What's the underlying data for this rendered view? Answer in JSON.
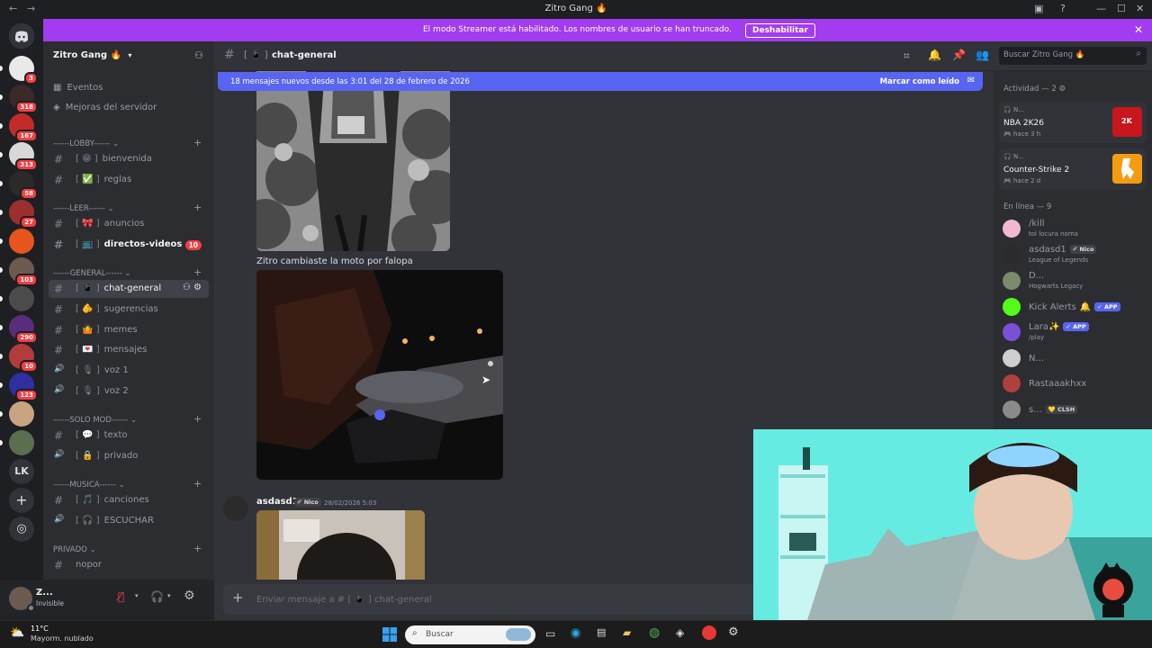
{
  "window": {
    "title": "Zitro Gang 🔥",
    "back_icon": "arrow-left",
    "forward_icon": "arrow-right"
  },
  "banner": {
    "text": "El modo Streamer está habilitado. Los nombres de usuario se han truncado.",
    "button": "Deshabilitar",
    "color": "#a23cf0"
  },
  "rail": {
    "servers": [
      {
        "badge": "3",
        "color": "#e9e9ea"
      },
      {
        "badge": "318",
        "color": "#3a2a2a"
      },
      {
        "badge": "167",
        "color": "#c32b2b"
      },
      {
        "badge": "313",
        "color": "#d8d8d8"
      },
      {
        "badge": "58",
        "color": "#2a2a2a"
      },
      {
        "badge": "27",
        "color": "#9b2f2f"
      },
      {
        "badge": "",
        "color": "#e8541e"
      },
      {
        "badge": "103",
        "color": "#6b5a4f"
      },
      {
        "badge": "",
        "color": "#4b4b4b"
      },
      {
        "badge": "290",
        "color": "#5a2c7c"
      },
      {
        "badge": "10",
        "color": "#b23c3c"
      },
      {
        "badge": "123",
        "color": "#2f2fa0"
      },
      {
        "badge": "",
        "color": "#c9a483"
      },
      {
        "badge": "",
        "color": "#5b6e4d"
      }
    ],
    "lk_label": "LK"
  },
  "sidebar": {
    "server_name": "Zitro Gang 🔥",
    "top_items": [
      "Eventos",
      "Mejoras del servidor"
    ],
    "categories": [
      {
        "label": "------LOBBY------"
      },
      {
        "label": "------LEER------"
      },
      {
        "label": "------GENERAL------"
      },
      {
        "label": "------SOLO MOD------"
      },
      {
        "label": "------MUSICA------"
      },
      {
        "label": "PRIVADO"
      }
    ],
    "channels": [
      {
        "name": "bienvenida",
        "emoji": "😁",
        "type": "text"
      },
      {
        "name": "reglas",
        "emoji": "✅",
        "type": "text"
      },
      {
        "name": "anuncios",
        "emoji": "🎀",
        "type": "text"
      },
      {
        "name": "directos-videos",
        "emoji": "📺",
        "type": "text",
        "badge": "10",
        "unread": true
      },
      {
        "name": "chat-general",
        "emoji": "📱",
        "type": "text",
        "selected": true
      },
      {
        "name": "sugerencias",
        "emoji": "🫵",
        "type": "text"
      },
      {
        "name": "memes",
        "emoji": "🤷",
        "type": "text"
      },
      {
        "name": "mensajes",
        "emoji": "💌",
        "type": "text"
      },
      {
        "name": "voz 1",
        "emoji": "🎙",
        "type": "voice"
      },
      {
        "name": "voz 2",
        "emoji": "🎙",
        "type": "voice"
      },
      {
        "name": "texto",
        "emoji": "💬",
        "type": "text"
      },
      {
        "name": "privado",
        "emoji": "🔒",
        "type": "voice"
      },
      {
        "name": "canciones",
        "emoji": "🎵",
        "type": "text"
      },
      {
        "name": "ESCUCHAR",
        "emoji": "🎧",
        "type": "voice"
      },
      {
        "name": "nopor",
        "emoji": "",
        "type": "text"
      }
    ]
  },
  "user": {
    "name": "Z...",
    "status": "Invisible"
  },
  "chat": {
    "channel": "chat-general",
    "channel_emoji": "📱",
    "new_messages": "18 mensajes nuevos desde las 3:01 del 28 de febrero de 2026",
    "mark_read": "Marcar como leído",
    "caption": "Zitro cambiaste la moto por falopa",
    "message_author": "asdasd1",
    "message_tag": "Nico",
    "message_time": "28/02/2026 5:03",
    "composer_placeholder": "Enviar mensaje a #",
    "composer_channel": "chat-general"
  },
  "search": {
    "placeholder": "Buscar Zitro Gang 🔥"
  },
  "members": {
    "activity_header": "Actividad — 2",
    "activities": [
      {
        "user": "N...",
        "game": "NBA 2K26",
        "time": "hace 3 h"
      },
      {
        "user": "N...",
        "game": "Counter-Strike 2",
        "time": "hace 2 d"
      }
    ],
    "online_header": "En línea — 9",
    "list": [
      {
        "name": "/kill",
        "status": "toi locura noma",
        "color": "#f2b8d2"
      },
      {
        "name": "asdasd1",
        "tag": "Nico",
        "status": "League of Legends",
        "color": "#2b2b2b"
      },
      {
        "name": "D...",
        "status": "Hogwarts Legacy",
        "color": "#7a8a6a"
      },
      {
        "name": "Kick Alerts",
        "bell": "🔔",
        "app": "APP",
        "color": "#53fc18"
      },
      {
        "name": "Lara✨",
        "app": "APP",
        "status": "/play",
        "color": "#7b4fd8"
      },
      {
        "name": "N...",
        "color": "#cfcfcf"
      },
      {
        "name": "Rastaaakhxx",
        "color": "#b04040"
      },
      {
        "name": "s...",
        "tag": "CLSH",
        "color": "#8a8a8a"
      }
    ]
  },
  "taskbar": {
    "temperature": "11°C",
    "weather": "Mayorm. nublado",
    "search": "Buscar"
  }
}
